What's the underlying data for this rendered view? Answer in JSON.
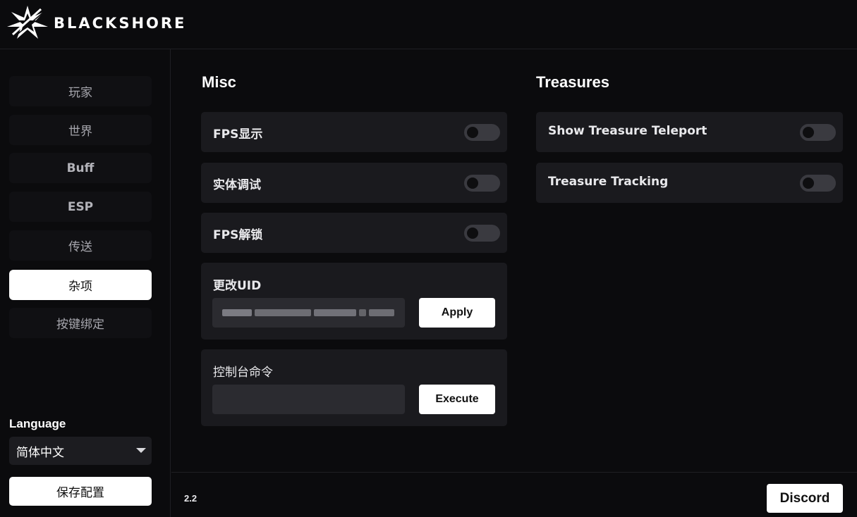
{
  "brand": {
    "name": "BLACKSHORE"
  },
  "sidebar": {
    "items": [
      {
        "label": "玩家"
      },
      {
        "label": "世界"
      },
      {
        "label": "Buff"
      },
      {
        "label": "ESP"
      },
      {
        "label": "传送"
      },
      {
        "label": "杂项",
        "active": true
      },
      {
        "label": "按键绑定"
      }
    ],
    "language_label": "Language",
    "language_value": "简体中文",
    "save_label": "保存配置"
  },
  "misc": {
    "title": "Misc",
    "toggles": [
      {
        "label": "FPS显示",
        "on": false
      },
      {
        "label": "实体调试",
        "on": false
      },
      {
        "label": "FPS解锁",
        "on": false
      }
    ],
    "uid": {
      "label": "更改UID",
      "button": "Apply"
    },
    "console": {
      "label": "控制台命令",
      "value": "",
      "button": "Execute"
    }
  },
  "treasures": {
    "title": "Treasures",
    "toggles": [
      {
        "label": "Show Treasure Teleport",
        "on": false
      },
      {
        "label": "Treasure Tracking",
        "on": false
      }
    ]
  },
  "footer": {
    "version": "2.2",
    "discord_label": "Discord"
  },
  "colors": {
    "background": "#0b0b0d",
    "panel": "#1a1a1e",
    "accent": "#ffffff"
  }
}
